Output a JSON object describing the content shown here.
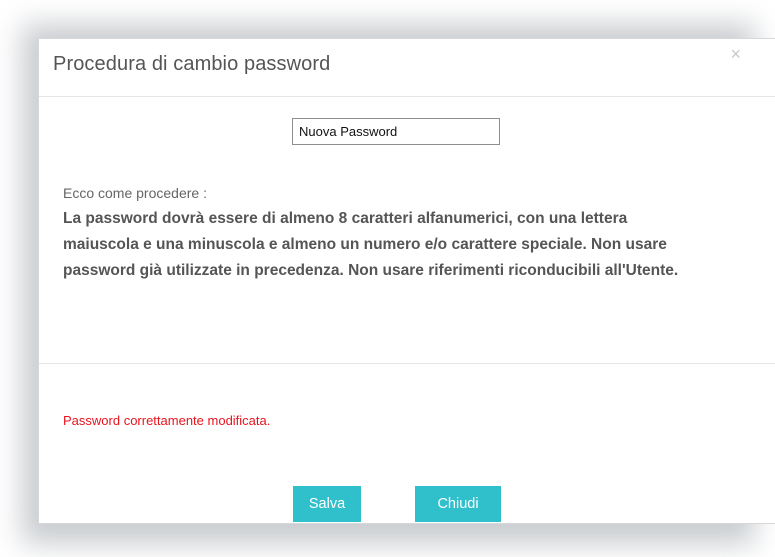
{
  "modal": {
    "title": "Procedura di cambio password",
    "close_label": "×"
  },
  "password_field": {
    "placeholder": "Nuova Password",
    "value": ""
  },
  "instructions": {
    "heading": "Ecco come procedere :",
    "body": "La password dovrà essere di almeno 8 caratteri alfanumerici, con una lettera maiuscola e una minuscola e almeno un numero e/o carattere speciale. Non usare password già utilizzate in precedenza. Non usare riferimenti riconducibili all'Utente."
  },
  "status": {
    "message": "Password correttamente modificata.",
    "color": "#e8141e"
  },
  "buttons": {
    "save_label": "Salva",
    "close_label": "Chiudi",
    "accent_color": "#2fc0cc"
  },
  "icons": {
    "close": "close-icon"
  }
}
